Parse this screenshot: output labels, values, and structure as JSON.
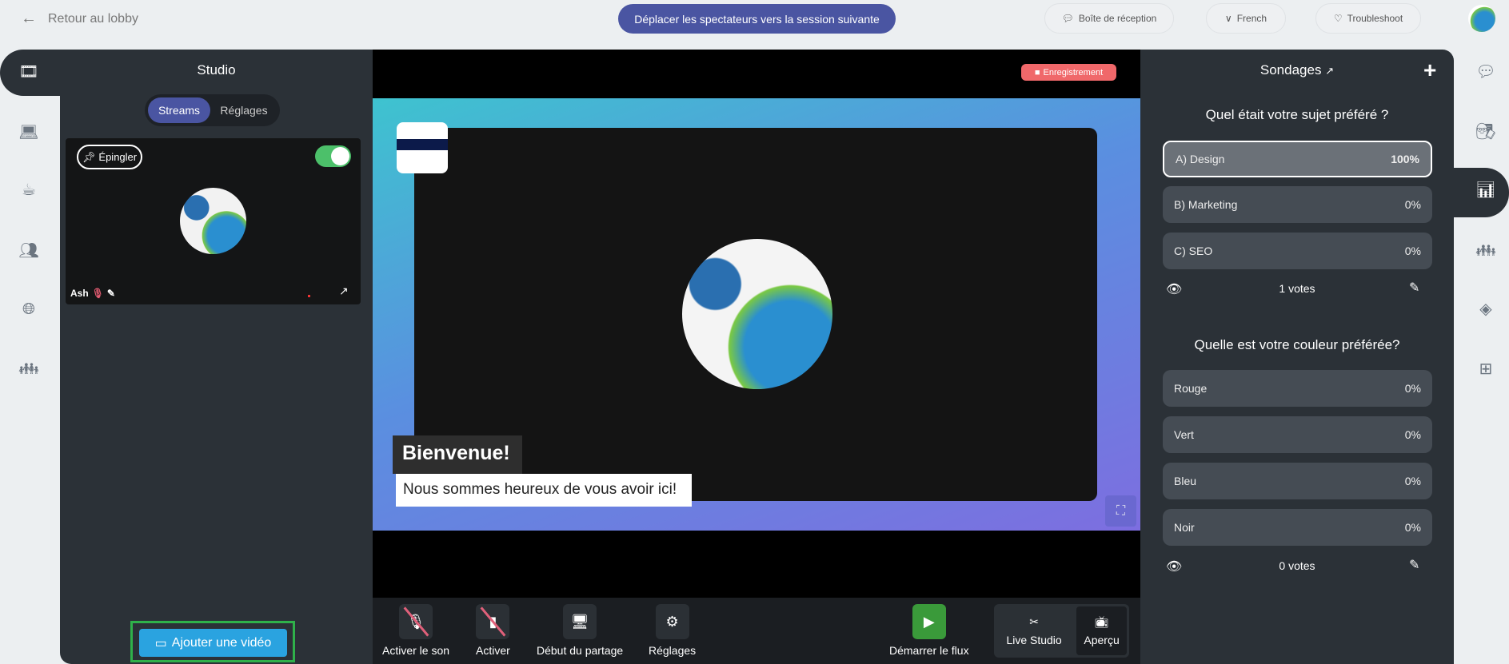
{
  "topbar": {
    "back_label": "Retour au lobby",
    "move_button": "Déplacer les spectateurs vers la session suivante",
    "inbox": "Boîte de réception",
    "language": "French",
    "troubleshoot": "Troubleshoot"
  },
  "studio": {
    "title": "Studio",
    "tabs": [
      "Streams",
      "Réglages"
    ],
    "active_tab": "Streams",
    "card": {
      "pin": "Épingler",
      "name": "Ash",
      "toggle_on": true
    },
    "add_video": "Ajouter une vidéo"
  },
  "stage": {
    "recording": "Enregistrement",
    "title": "Bienvenue!",
    "subtitle": "Nous sommes heureux de vous avoir ici!"
  },
  "toolbar": {
    "unmute": "Activer le son",
    "camera": "Activer",
    "share": "Début du partage",
    "settings": "Réglages",
    "start_stream": "Démarrer le flux",
    "live_studio": "Live Studio",
    "preview": "Aperçu"
  },
  "polls": {
    "title": "Sondages",
    "questions": [
      {
        "question": "Quel était votre sujet préféré ?",
        "options": [
          {
            "label": "A) Design",
            "pct": "100%"
          },
          {
            "label": "B) Marketing",
            "pct": "0%"
          },
          {
            "label": "C) SEO",
            "pct": "0%"
          }
        ],
        "votes": "1 votes"
      },
      {
        "question": "Quelle est votre couleur préférée?",
        "options": [
          {
            "label": "Rouge",
            "pct": "0%"
          },
          {
            "label": "Vert",
            "pct": "0%"
          },
          {
            "label": "Bleu",
            "pct": "0%"
          },
          {
            "label": "Noir",
            "pct": "0%"
          }
        ],
        "votes": "0 votes"
      }
    ]
  },
  "colors": {
    "accent": "#4a55a2",
    "recording": "#f0686a",
    "start": "#3a9a3a",
    "add_video": "#2aa3e0",
    "highlight": "#2fb14a"
  }
}
